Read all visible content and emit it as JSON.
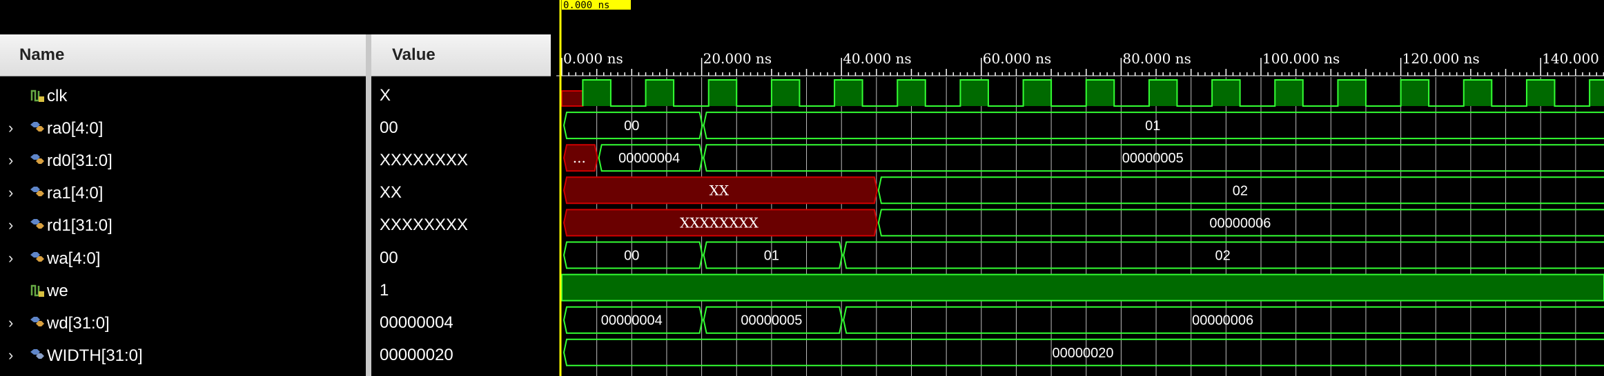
{
  "header": {
    "name": "Name",
    "value": "Value"
  },
  "cursor": {
    "label": "0.000 ns"
  },
  "ruler": {
    "unit": "ns",
    "ticks": [
      "0.000 ns",
      "20.000 ns",
      "40.000 ns",
      "60.000 ns",
      "80.000 ns",
      "100.000 ns",
      "120.000 ns",
      "140.000 ns"
    ]
  },
  "colors": {
    "signal": "#33ff33",
    "fill": "#006a00",
    "unknown": "#d00000",
    "unknownFill": "#6a0000",
    "cursor": "#ffff00",
    "grid": "#ffffff"
  },
  "signals": [
    {
      "name": "clk",
      "value": "X",
      "expandable": false,
      "icon": "scalar-signal-icon",
      "type": "clock"
    },
    {
      "name": "ra0[4:0]",
      "value": "00",
      "expandable": true,
      "icon": "bus-signal-icon",
      "type": "bus",
      "segments": [
        {
          "from": 0,
          "to": 20,
          "label": "00"
        },
        {
          "from": 20,
          "to": 150,
          "label": "01"
        }
      ]
    },
    {
      "name": "rd0[31:0]",
      "value": "XXXXXXXX",
      "expandable": true,
      "icon": "bus-signal-icon",
      "type": "bus",
      "segments": [
        {
          "from": 0,
          "to": 5,
          "label": "...",
          "unknown": true
        },
        {
          "from": 5,
          "to": 20,
          "label": "00000004"
        },
        {
          "from": 20,
          "to": 150,
          "label": "00000005"
        }
      ]
    },
    {
      "name": "ra1[4:0]",
      "value": "XX",
      "expandable": true,
      "icon": "bus-signal-icon",
      "type": "bus",
      "segments": [
        {
          "from": 0,
          "to": 45,
          "label": "XX",
          "unknown": true
        },
        {
          "from": 45,
          "to": 150,
          "label": "02"
        }
      ]
    },
    {
      "name": "rd1[31:0]",
      "value": "XXXXXXXX",
      "expandable": true,
      "icon": "bus-signal-icon",
      "type": "bus",
      "segments": [
        {
          "from": 0,
          "to": 45,
          "label": "XXXXXXXX",
          "unknown": true
        },
        {
          "from": 45,
          "to": 150,
          "label": "00000006"
        }
      ]
    },
    {
      "name": "wa[4:0]",
      "value": "00",
      "expandable": true,
      "icon": "bus-signal-icon",
      "type": "bus",
      "segments": [
        {
          "from": 0,
          "to": 20,
          "label": "00"
        },
        {
          "from": 20,
          "to": 40,
          "label": "01"
        },
        {
          "from": 40,
          "to": 150,
          "label": "02"
        }
      ]
    },
    {
      "name": "we",
      "value": "1",
      "expandable": false,
      "icon": "scalar-signal-icon",
      "type": "high"
    },
    {
      "name": "wd[31:0]",
      "value": "00000004",
      "expandable": true,
      "icon": "bus-signal-icon",
      "type": "bus",
      "segments": [
        {
          "from": 0,
          "to": 20,
          "label": "00000004"
        },
        {
          "from": 20,
          "to": 40,
          "label": "00000005"
        },
        {
          "from": 40,
          "to": 150,
          "label": "00000006"
        }
      ]
    },
    {
      "name": "WIDTH[31:0]",
      "value": "00000020",
      "expandable": true,
      "icon": "param-signal-icon",
      "type": "bus",
      "segments": [
        {
          "from": 0,
          "to": 150,
          "label": "00000020"
        }
      ]
    }
  ]
}
